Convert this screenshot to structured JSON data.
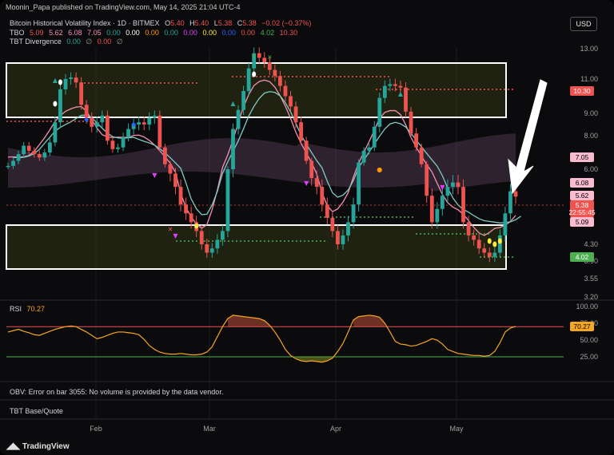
{
  "header": {
    "text": "Moonin_Papa published on TradingView.com, May 14, 2025 21:04 UTC-4"
  },
  "currency_button": "USD",
  "legend": {
    "symbol": "Bitcoin Historical Volatility Index · 1D · BITMEX",
    "ohlc": {
      "o_label": "O",
      "o": "5.40",
      "h_label": "H",
      "h": "5.40",
      "l_label": "L",
      "l": "5.38",
      "c_label": "C",
      "c": "5.38",
      "change": "−0.02 (−0.37%)"
    },
    "tbo": {
      "label": "TBO",
      "values": [
        "5.09",
        "5.62",
        "6.08",
        "7.05",
        "0.00",
        "0.00",
        "0.00",
        "0.00",
        "0.00",
        "0.00",
        "0.00",
        "0.00",
        "4.02",
        "10.30"
      ]
    },
    "tbt": {
      "label": "TBT Divergence",
      "values": [
        "0.00",
        "∅",
        "0.00",
        "∅"
      ]
    },
    "rsi": {
      "label": "RSI",
      "value": "70.27"
    },
    "obv": {
      "text": "OBV: Error on bar 3055: No volume is provided by the data vendor."
    },
    "tbt_base": {
      "text": "TBT Base/Quote"
    }
  },
  "brand": "TradingView",
  "colors": {
    "up": "#26a69a",
    "down": "#ef5350",
    "rsi_line": "#f5a623",
    "ma_pink": "#f48fb1",
    "ma_teal": "#80cbc4"
  },
  "chart_data": {
    "type": "candlestick",
    "y_ticks": [
      "13.00",
      "11.00",
      "9.00",
      "8.00",
      "6.00",
      "4.30",
      "3.90",
      "3.55",
      "3.20"
    ],
    "y_tick_values": [
      13.0,
      11.0,
      9.0,
      8.0,
      6.0,
      4.3,
      3.9,
      3.55,
      3.2
    ],
    "x_ticks": [
      "Feb",
      "Mar",
      "Apr",
      "May"
    ],
    "price_tags": [
      {
        "label": "10.30",
        "kind": "resistance"
      },
      {
        "label": "7.05",
        "kind": "level"
      },
      {
        "label": "6.08",
        "kind": "level"
      },
      {
        "label": "5.62",
        "kind": "level"
      },
      {
        "label": "5.38",
        "kind": "last"
      },
      {
        "label": "22:55:45",
        "kind": "countdown"
      },
      {
        "label": "5.09",
        "kind": "level"
      },
      {
        "label": "4.02",
        "kind": "support"
      }
    ],
    "close_series": [
      6.2,
      6.5,
      6.9,
      7.4,
      7.1,
      6.9,
      6.7,
      7.0,
      7.6,
      8.6,
      10.4,
      11.0,
      11.1,
      10.8,
      9.5,
      8.8,
      8.4,
      8.6,
      8.9,
      7.7,
      7.2,
      7.3,
      7.9,
      8.3,
      8.5,
      8.6,
      8.5,
      8.8,
      8.9,
      7.3,
      6.3,
      5.9,
      5.6,
      5.2,
      5.0,
      4.8,
      4.6,
      4.3,
      4.1,
      4.2,
      4.4,
      4.6,
      6.0,
      8.3,
      9.2,
      10.3,
      11.7,
      12.7,
      12.4,
      12.1,
      11.6,
      11.2,
      10.6,
      10.0,
      9.4,
      8.6,
      7.7,
      6.5,
      5.8,
      5.6,
      5.2,
      4.9,
      4.6,
      4.3,
      4.5,
      4.8,
      5.2,
      6.4,
      7.1,
      7.3,
      8.4,
      9.9,
      10.6,
      10.7,
      10.6,
      10.5,
      9.1,
      8.1,
      7.3,
      6.3,
      5.4,
      4.8,
      5.1,
      5.4,
      5.6,
      5.7,
      5.6,
      4.8,
      4.5,
      4.4,
      4.2,
      4.1,
      4.0,
      4.1,
      4.5,
      5.0,
      5.5,
      5.38
    ],
    "rsi": {
      "ylim": [
        0,
        100
      ],
      "ticks": [
        "100.00",
        "75.00",
        "50.00",
        "25.00"
      ],
      "tick_values": [
        100,
        75,
        50,
        25
      ],
      "levels": [
        70,
        25
      ],
      "series": [
        62,
        64,
        66,
        63,
        61,
        58,
        57,
        60,
        63,
        66,
        68,
        70,
        71,
        70,
        66,
        62,
        57,
        52,
        54,
        57,
        60,
        62,
        62,
        61,
        60,
        58,
        51,
        42,
        36,
        32,
        30,
        29,
        29,
        30,
        29,
        28,
        28,
        29,
        32,
        40,
        55,
        70,
        82,
        87,
        86,
        85,
        84,
        83,
        82,
        79,
        72,
        62,
        50,
        36,
        27,
        22,
        19,
        18,
        19,
        18,
        17,
        19,
        23,
        33,
        45,
        62,
        80,
        85,
        86,
        87,
        86,
        84,
        75,
        62,
        48,
        44,
        43,
        41,
        42,
        45,
        48,
        52,
        50,
        44,
        36,
        33,
        30,
        29,
        28,
        27,
        27,
        26,
        27,
        33,
        46,
        62,
        68,
        70.27
      ],
      "last_tag": "70.27"
    }
  }
}
